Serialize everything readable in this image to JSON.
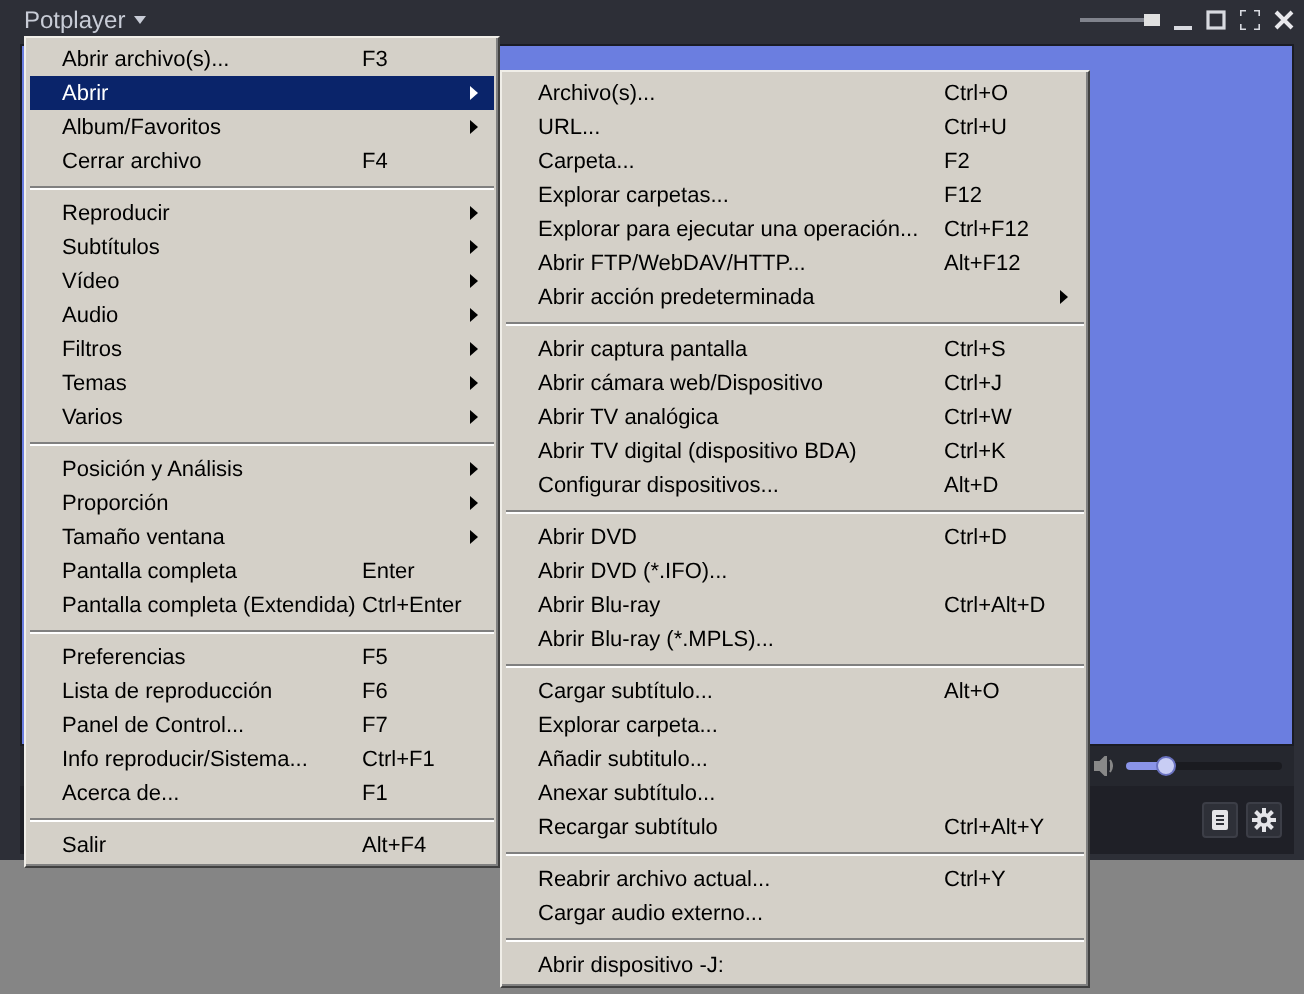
{
  "window": {
    "title": "Potplayer",
    "opacity_slider": {
      "level": 0.9
    }
  },
  "volume": {
    "level": 0.25
  },
  "main_menu": [
    {
      "kind": "item",
      "label": "Abrir archivo(s)...",
      "shortcut": "F3",
      "submenu": false,
      "selected": false
    },
    {
      "kind": "item",
      "label": "Abrir",
      "submenu": true,
      "selected": true
    },
    {
      "kind": "item",
      "label": "Album/Favoritos",
      "submenu": true,
      "selected": false
    },
    {
      "kind": "item",
      "label": "Cerrar archivo",
      "shortcut": "F4",
      "submenu": false,
      "selected": false
    },
    {
      "kind": "separator"
    },
    {
      "kind": "item",
      "label": "Reproducir",
      "submenu": true,
      "selected": false
    },
    {
      "kind": "item",
      "label": "Subtítulos",
      "submenu": true,
      "selected": false
    },
    {
      "kind": "item",
      "label": "Vídeo",
      "submenu": true,
      "selected": false
    },
    {
      "kind": "item",
      "label": "Audio",
      "submenu": true,
      "selected": false
    },
    {
      "kind": "item",
      "label": "Filtros",
      "submenu": true,
      "selected": false
    },
    {
      "kind": "item",
      "label": "Temas",
      "submenu": true,
      "selected": false
    },
    {
      "kind": "item",
      "label": "Varios",
      "submenu": true,
      "selected": false
    },
    {
      "kind": "separator"
    },
    {
      "kind": "item",
      "label": "Posición y Análisis",
      "submenu": true,
      "selected": false
    },
    {
      "kind": "item",
      "label": "Proporción",
      "submenu": true,
      "selected": false
    },
    {
      "kind": "item",
      "label": "Tamaño ventana",
      "submenu": true,
      "selected": false
    },
    {
      "kind": "item",
      "label": "Pantalla completa",
      "shortcut": "Enter",
      "submenu": false,
      "selected": false
    },
    {
      "kind": "item",
      "label": "Pantalla completa (Extendida)",
      "shortcut": "Ctrl+Enter",
      "submenu": false,
      "selected": false
    },
    {
      "kind": "separator"
    },
    {
      "kind": "item",
      "label": "Preferencias",
      "shortcut": "F5",
      "submenu": false,
      "selected": false
    },
    {
      "kind": "item",
      "label": "Lista de reproducción",
      "shortcut": "F6",
      "submenu": false,
      "selected": false
    },
    {
      "kind": "item",
      "label": "Panel de Control...",
      "shortcut": "F7",
      "submenu": false,
      "selected": false
    },
    {
      "kind": "item",
      "label": "Info reproducir/Sistema...",
      "shortcut": "Ctrl+F1",
      "submenu": false,
      "selected": false
    },
    {
      "kind": "item",
      "label": "Acerca de...",
      "shortcut": "F1",
      "submenu": false,
      "selected": false
    },
    {
      "kind": "separator"
    },
    {
      "kind": "item",
      "label": "Salir",
      "shortcut": "Alt+F4",
      "submenu": false,
      "selected": false
    }
  ],
  "submenu": [
    {
      "kind": "item",
      "label": "Archivo(s)...",
      "shortcut": "Ctrl+O",
      "submenu": false,
      "selected": false
    },
    {
      "kind": "item",
      "label": "URL...",
      "shortcut": "Ctrl+U",
      "submenu": false,
      "selected": false
    },
    {
      "kind": "item",
      "label": "Carpeta...",
      "shortcut": "F2",
      "submenu": false,
      "selected": false
    },
    {
      "kind": "item",
      "label": "Explorar carpetas...",
      "shortcut": "F12",
      "submenu": false,
      "selected": false
    },
    {
      "kind": "item",
      "label": "Explorar para ejecutar una operación...",
      "shortcut": "Ctrl+F12",
      "submenu": false,
      "selected": false
    },
    {
      "kind": "item",
      "label": "Abrir FTP/WebDAV/HTTP...",
      "shortcut": "Alt+F12",
      "submenu": false,
      "selected": false
    },
    {
      "kind": "item",
      "label": "Abrir acción predeterminada",
      "submenu": true,
      "selected": false
    },
    {
      "kind": "separator"
    },
    {
      "kind": "item",
      "label": "Abrir captura pantalla",
      "shortcut": "Ctrl+S",
      "submenu": false,
      "selected": false
    },
    {
      "kind": "item",
      "label": "Abrir cámara web/Dispositivo",
      "shortcut": "Ctrl+J",
      "submenu": false,
      "selected": false
    },
    {
      "kind": "item",
      "label": "Abrir TV analógica",
      "shortcut": "Ctrl+W",
      "submenu": false,
      "selected": false
    },
    {
      "kind": "item",
      "label": "Abrir TV digital (dispositivo BDA)",
      "shortcut": "Ctrl+K",
      "submenu": false,
      "selected": false
    },
    {
      "kind": "item",
      "label": "Configurar dispositivos...",
      "shortcut": "Alt+D",
      "submenu": false,
      "selected": false
    },
    {
      "kind": "separator"
    },
    {
      "kind": "item",
      "label": "Abrir DVD",
      "shortcut": "Ctrl+D",
      "submenu": false,
      "selected": false
    },
    {
      "kind": "item",
      "label": "Abrir DVD (*.IFO)...",
      "submenu": false,
      "selected": false
    },
    {
      "kind": "item",
      "label": "Abrir Blu-ray",
      "shortcut": "Ctrl+Alt+D",
      "submenu": false,
      "selected": false
    },
    {
      "kind": "item",
      "label": "Abrir Blu-ray (*.MPLS)...",
      "submenu": false,
      "selected": false
    },
    {
      "kind": "separator"
    },
    {
      "kind": "item",
      "label": "Cargar subtítulo...",
      "shortcut": "Alt+O",
      "submenu": false,
      "selected": false
    },
    {
      "kind": "item",
      "label": "Explorar carpeta...",
      "submenu": false,
      "selected": false
    },
    {
      "kind": "item",
      "label": "Añadir subtitulo...",
      "submenu": false,
      "selected": false
    },
    {
      "kind": "item",
      "label": "Anexar subtítulo...",
      "submenu": false,
      "selected": false
    },
    {
      "kind": "item",
      "label": "Recargar subtítulo",
      "shortcut": "Ctrl+Alt+Y",
      "submenu": false,
      "selected": false
    },
    {
      "kind": "separator"
    },
    {
      "kind": "item",
      "label": "Reabrir archivo actual...",
      "shortcut": "Ctrl+Y",
      "submenu": false,
      "selected": false
    },
    {
      "kind": "item",
      "label": "Cargar audio externo...",
      "submenu": false,
      "selected": false
    },
    {
      "kind": "separator"
    },
    {
      "kind": "item",
      "label": "Abrir dispositivo -J:",
      "submenu": false,
      "selected": false
    }
  ]
}
